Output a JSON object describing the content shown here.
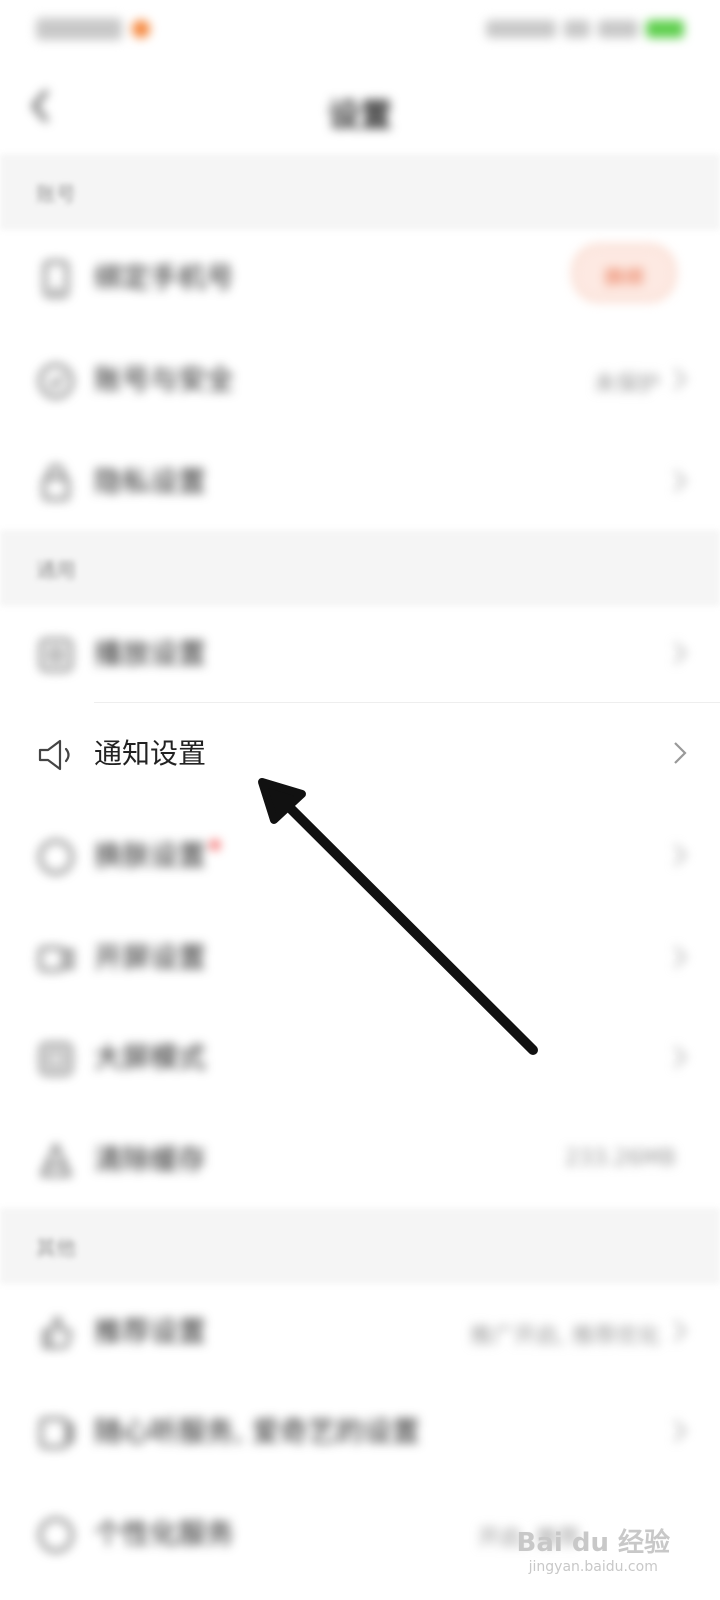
{
  "status_bar": {
    "accent_color": "#f5883f",
    "battery_color": "#5fcf4e"
  },
  "nav": {
    "title": "设置"
  },
  "sections": [
    {
      "header": "账号",
      "items": [
        {
          "label": "绑定手机号",
          "badge": "换绑"
        },
        {
          "label": "账号与安全",
          "value": "未保护"
        },
        {
          "label": "隐私设置"
        }
      ]
    },
    {
      "header": "通用",
      "items": [
        {
          "label": "播放设置"
        },
        {
          "label": "通知设置"
        },
        {
          "label": "换肤设置"
        },
        {
          "label": "开屏设置"
        },
        {
          "label": "大屏模式"
        },
        {
          "label": "清除缓存",
          "value": "233.26MB"
        }
      ]
    },
    {
      "header": "其他",
      "items": [
        {
          "label": "推荐设置",
          "value": "推广开启, 推荐优化"
        },
        {
          "label": "随心听服务, 爱奇艺的设置"
        },
        {
          "label": "个性化服务",
          "value": "开启, 推荐"
        }
      ]
    }
  ],
  "watermark": {
    "brand": "Bai du 经验",
    "url": "jingyan.baidu.com"
  },
  "colors": {
    "accent": "#e8714d",
    "section_bg": "#f5f5f5",
    "annotation_arrow": "#111111"
  }
}
